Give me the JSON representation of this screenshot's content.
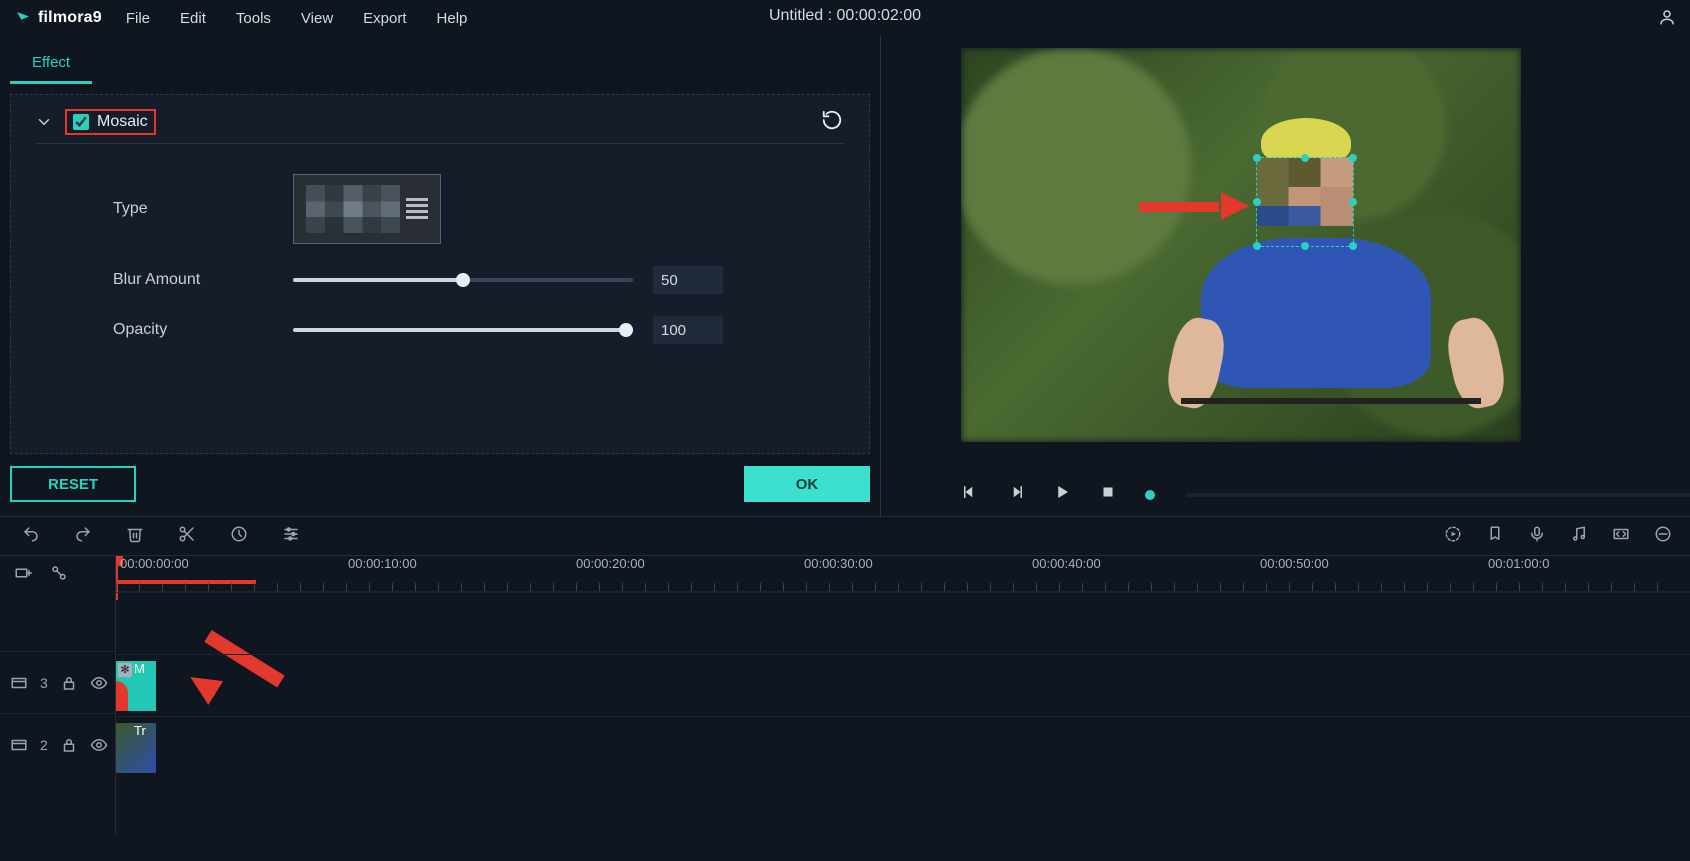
{
  "brand": {
    "name": "filmora",
    "version": "9"
  },
  "menu": {
    "file": "File",
    "edit": "Edit",
    "tools": "Tools",
    "view": "View",
    "export": "Export",
    "help": "Help"
  },
  "title": "Untitled : 00:00:02:00",
  "tab": {
    "effect": "Effect"
  },
  "effect": {
    "name": "Mosaic",
    "checked": true,
    "type_label": "Type",
    "blur_label": "Blur Amount",
    "blur_value": "50",
    "opacity_label": "Opacity",
    "opacity_value": "100"
  },
  "buttons": {
    "reset": "RESET",
    "ok": "OK"
  },
  "timeline": {
    "marks": [
      "00:00:00:00",
      "00:00:10:00",
      "00:00:20:00",
      "00:00:30:00",
      "00:00:40:00",
      "00:00:50:00",
      "00:01:00:0"
    ],
    "tracks": [
      {
        "num": "3",
        "clip_label": "M"
      },
      {
        "num": "2",
        "clip_label": "Tr"
      }
    ]
  }
}
